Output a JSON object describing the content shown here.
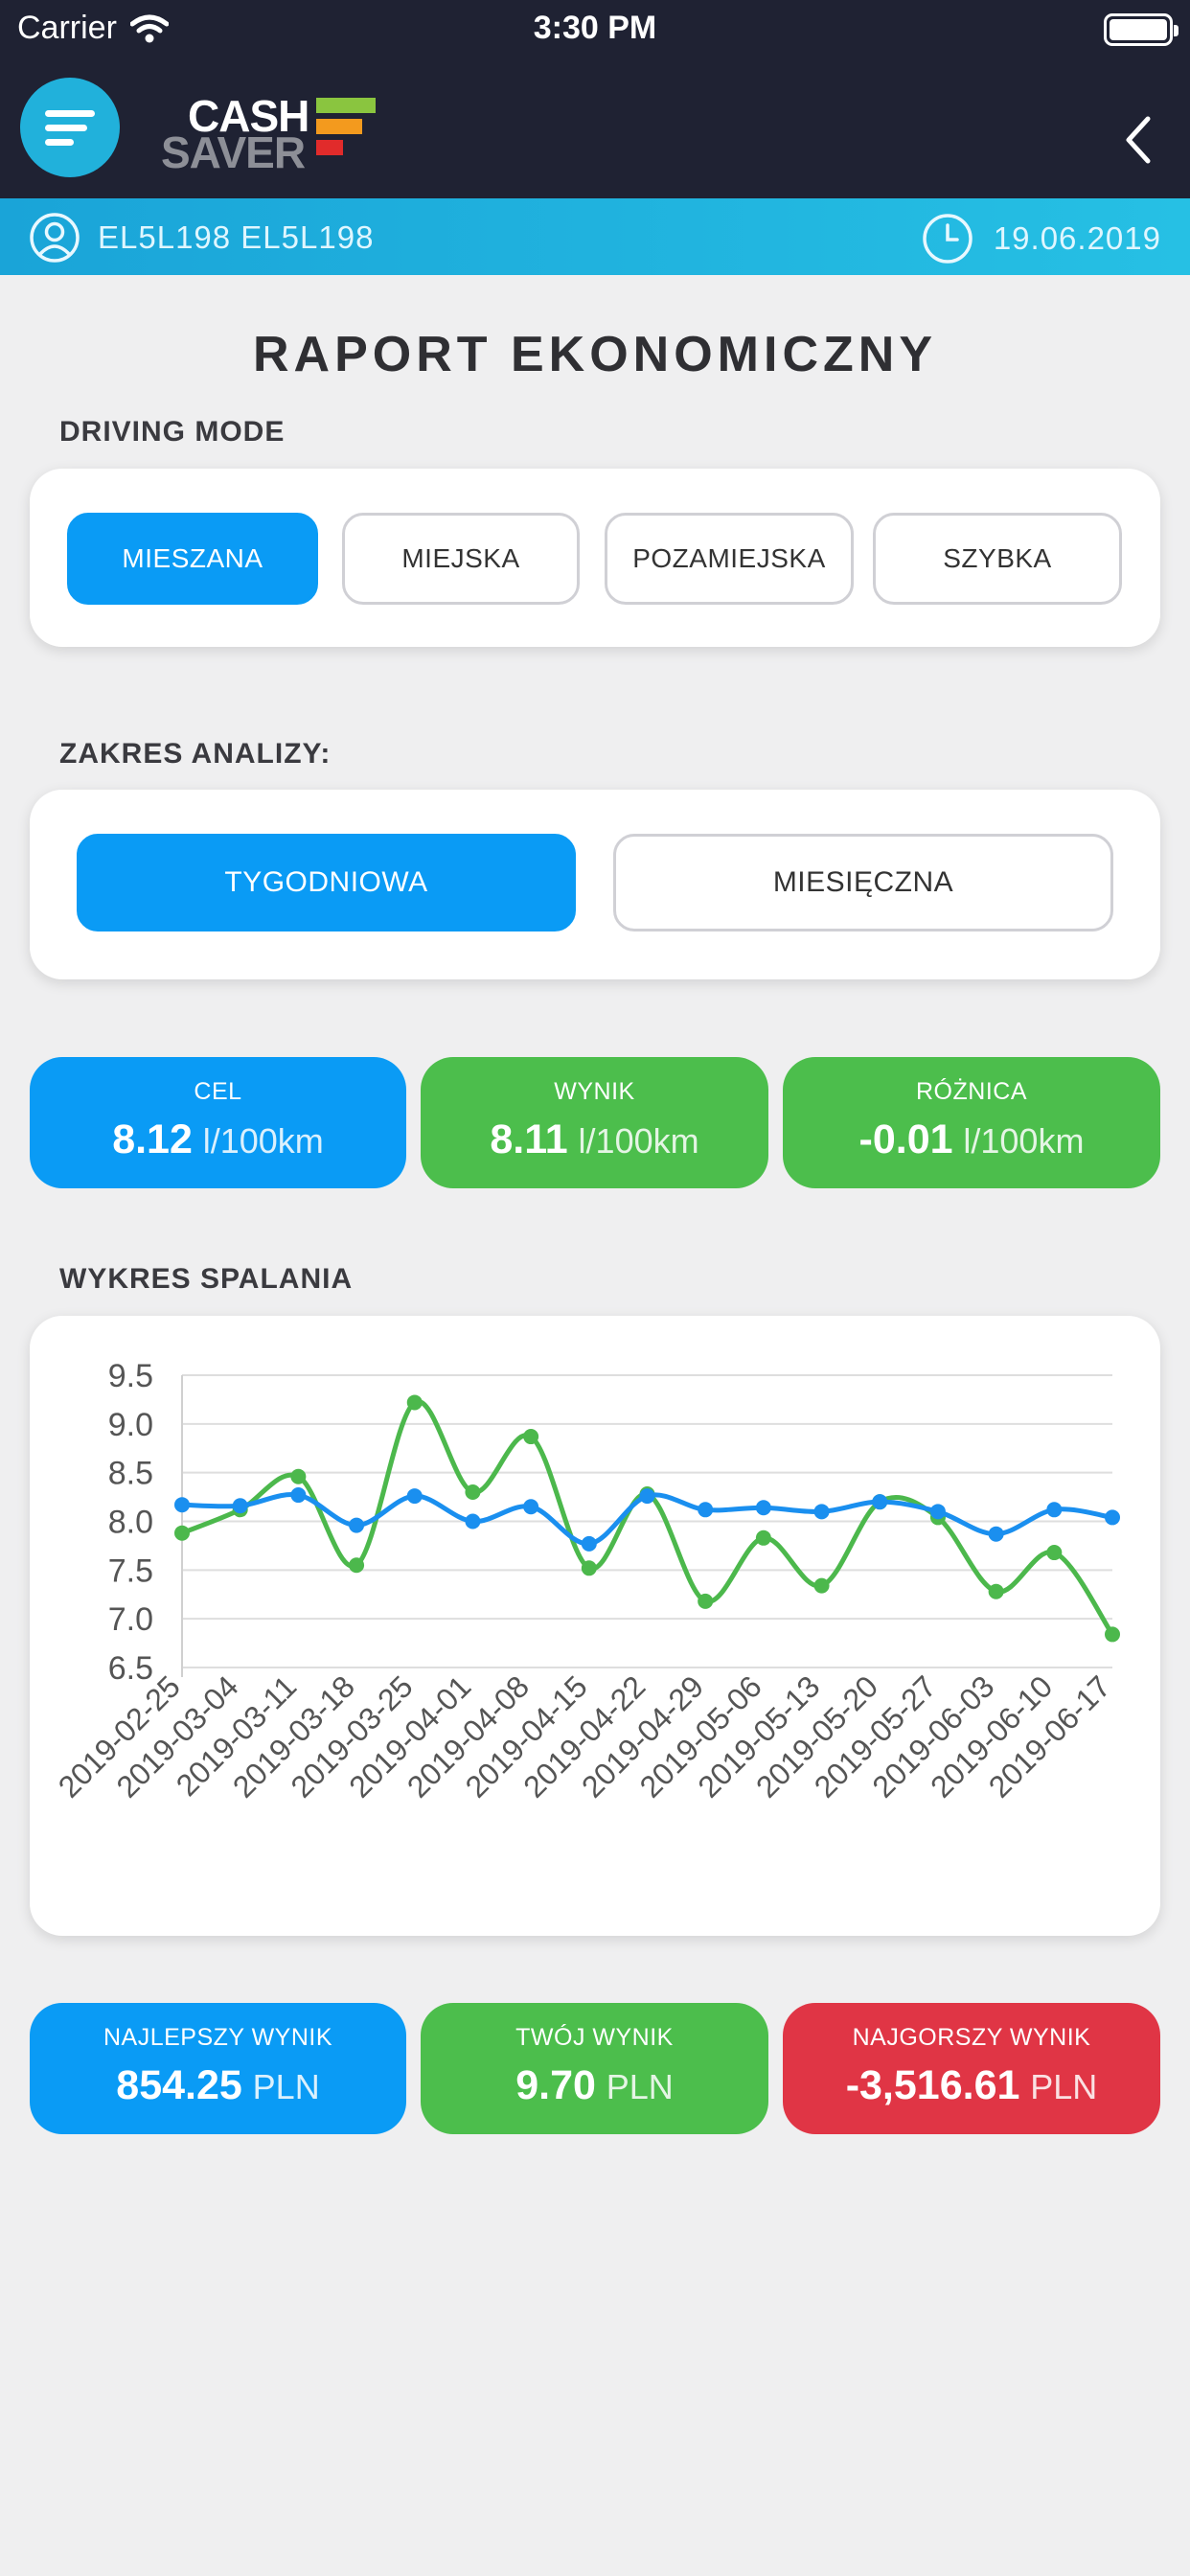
{
  "status_bar": {
    "carrier": "Carrier",
    "time": "3:30 PM"
  },
  "header": {
    "logo_line1": "CASH",
    "logo_line2": "SAVER"
  },
  "user_bar": {
    "user": "EL5L198 EL5L198",
    "date": "19.06.2019"
  },
  "page_title": "RAPORT EKONOMICZNY",
  "driving_mode": {
    "label": "DRIVING MODE",
    "options": [
      "MIESZANA",
      "MIEJSKA",
      "POZAMIEJSKA",
      "SZYBKA"
    ],
    "selected": "MIESZANA"
  },
  "analysis_range": {
    "label": "ZAKRES ANALIZY:",
    "options": [
      "TYGODNIOWA",
      "MIESIĘCZNA"
    ],
    "selected": "TYGODNIOWA"
  },
  "consumption_stats": {
    "target": {
      "label": "CEL",
      "value": "8.12",
      "unit": "l/100km"
    },
    "result": {
      "label": "WYNIK",
      "value": "8.11",
      "unit": "l/100km"
    },
    "difference": {
      "label": "RÓŻNICA",
      "value": "-0.01",
      "unit": "l/100km"
    }
  },
  "chart_section_label": "WYKRES SPALANIA",
  "chart_data": {
    "type": "line",
    "title": "",
    "xlabel": "",
    "ylabel": "",
    "x": [
      "2019-02-25",
      "2019-03-04",
      "2019-03-11",
      "2019-03-18",
      "2019-03-25",
      "2019-04-01",
      "2019-04-08",
      "2019-04-15",
      "2019-04-22",
      "2019-04-29",
      "2019-05-06",
      "2019-05-13",
      "2019-05-20",
      "2019-05-27",
      "2019-06-03",
      "2019-06-10",
      "2019-06-17"
    ],
    "ylim": [
      6.5,
      9.5
    ],
    "yticks": [
      9.5,
      9.0,
      8.5,
      8.0,
      7.5,
      7.0,
      6.5
    ],
    "grid": true,
    "series": [
      {
        "color": "#1a8fef",
        "values": [
          8.17,
          8.16,
          8.27,
          7.96,
          8.26,
          8.0,
          8.15,
          7.77,
          8.26,
          8.12,
          8.14,
          8.1,
          8.2,
          8.1,
          7.87,
          8.12,
          8.04
        ]
      },
      {
        "color": "#4cb84c",
        "values": [
          7.88,
          8.12,
          8.46,
          7.55,
          9.22,
          8.3,
          8.87,
          7.52,
          8.28,
          7.18,
          7.83,
          7.34,
          8.2,
          8.04,
          7.28,
          7.68,
          6.84
        ]
      }
    ]
  },
  "score_stats": {
    "best": {
      "label": "NAJLEPSZY WYNIK",
      "value": "854.25",
      "unit": "PLN"
    },
    "yours": {
      "label": "TWÓJ WYNIK",
      "value": "9.70",
      "unit": "PLN"
    },
    "worst": {
      "label": "NAJGORSZY WYNIK",
      "value": "-3,516.61",
      "unit": "PLN"
    }
  },
  "colors": {
    "accent_blue": "#0a9bf5",
    "green": "#4cbe4c",
    "red": "#e03545",
    "header_bg": "#1f2233",
    "user_bar": "#1aa4d8"
  }
}
